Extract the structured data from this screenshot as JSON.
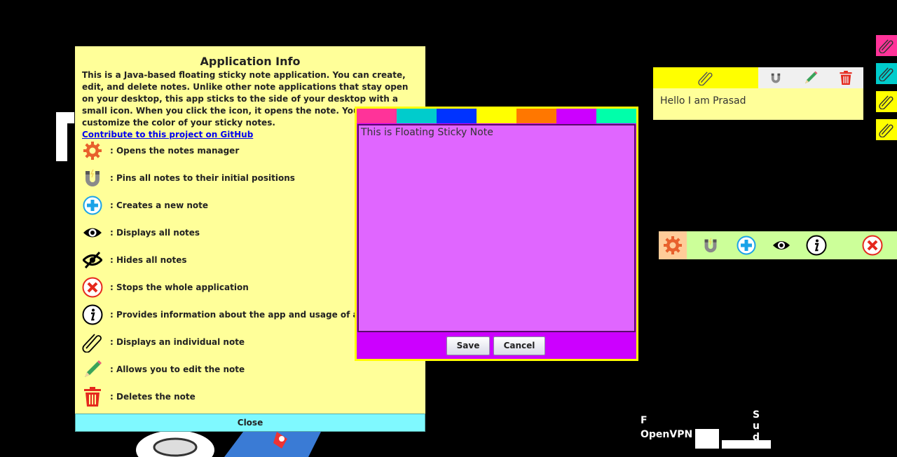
{
  "info": {
    "title": "Application Info",
    "description": "This is a Java-based floating sticky note application. You can create, edit, and delete notes. Unlike other note applications that stay open on your desktop, this app sticks to the side of your desktop with a small icon. When you click the icon, it opens the note. You can also customize the color of your sticky notes.",
    "github_link": "Contribute to this project on GitHub",
    "legend": [
      {
        "icon": "gear-icon",
        "text": ": Opens the notes manager"
      },
      {
        "icon": "magnet-icon",
        "text": ": Pins all notes to their initial positions"
      },
      {
        "icon": "plus-circle-icon",
        "text": ": Creates a new note"
      },
      {
        "icon": "eye-icon",
        "text": ": Displays all notes"
      },
      {
        "icon": "eye-slash-icon",
        "text": ": Hides all notes"
      },
      {
        "icon": "close-circle-icon",
        "text": ": Stops the whole application"
      },
      {
        "icon": "info-icon",
        "text": ": Provides information about the app and usage of application"
      },
      {
        "icon": "paperclip-icon",
        "text": ": Displays an individual note"
      },
      {
        "icon": "pencil-icon",
        "text": ": Allows you to edit the note"
      },
      {
        "icon": "trash-icon",
        "text": ": Deletes the note"
      }
    ],
    "close_label": "Close"
  },
  "editor": {
    "colors": [
      "#ff3399",
      "#00cccc",
      "#0033ff",
      "#ffff00",
      "#ff7700",
      "#cc00ff",
      "#00ffaa"
    ],
    "text": "This is Floating Sticky Note",
    "save_label": "Save",
    "cancel_label": "Cancel"
  },
  "sticky_note": {
    "text": "Hello I am Prasad"
  },
  "edge_tabs": [
    "#ff3399",
    "#00cccc",
    "#ffff00",
    "#ffff00"
  ],
  "desktop": {
    "labels": [
      "F",
      "OpenVPN",
      "S",
      "u",
      "d"
    ]
  }
}
